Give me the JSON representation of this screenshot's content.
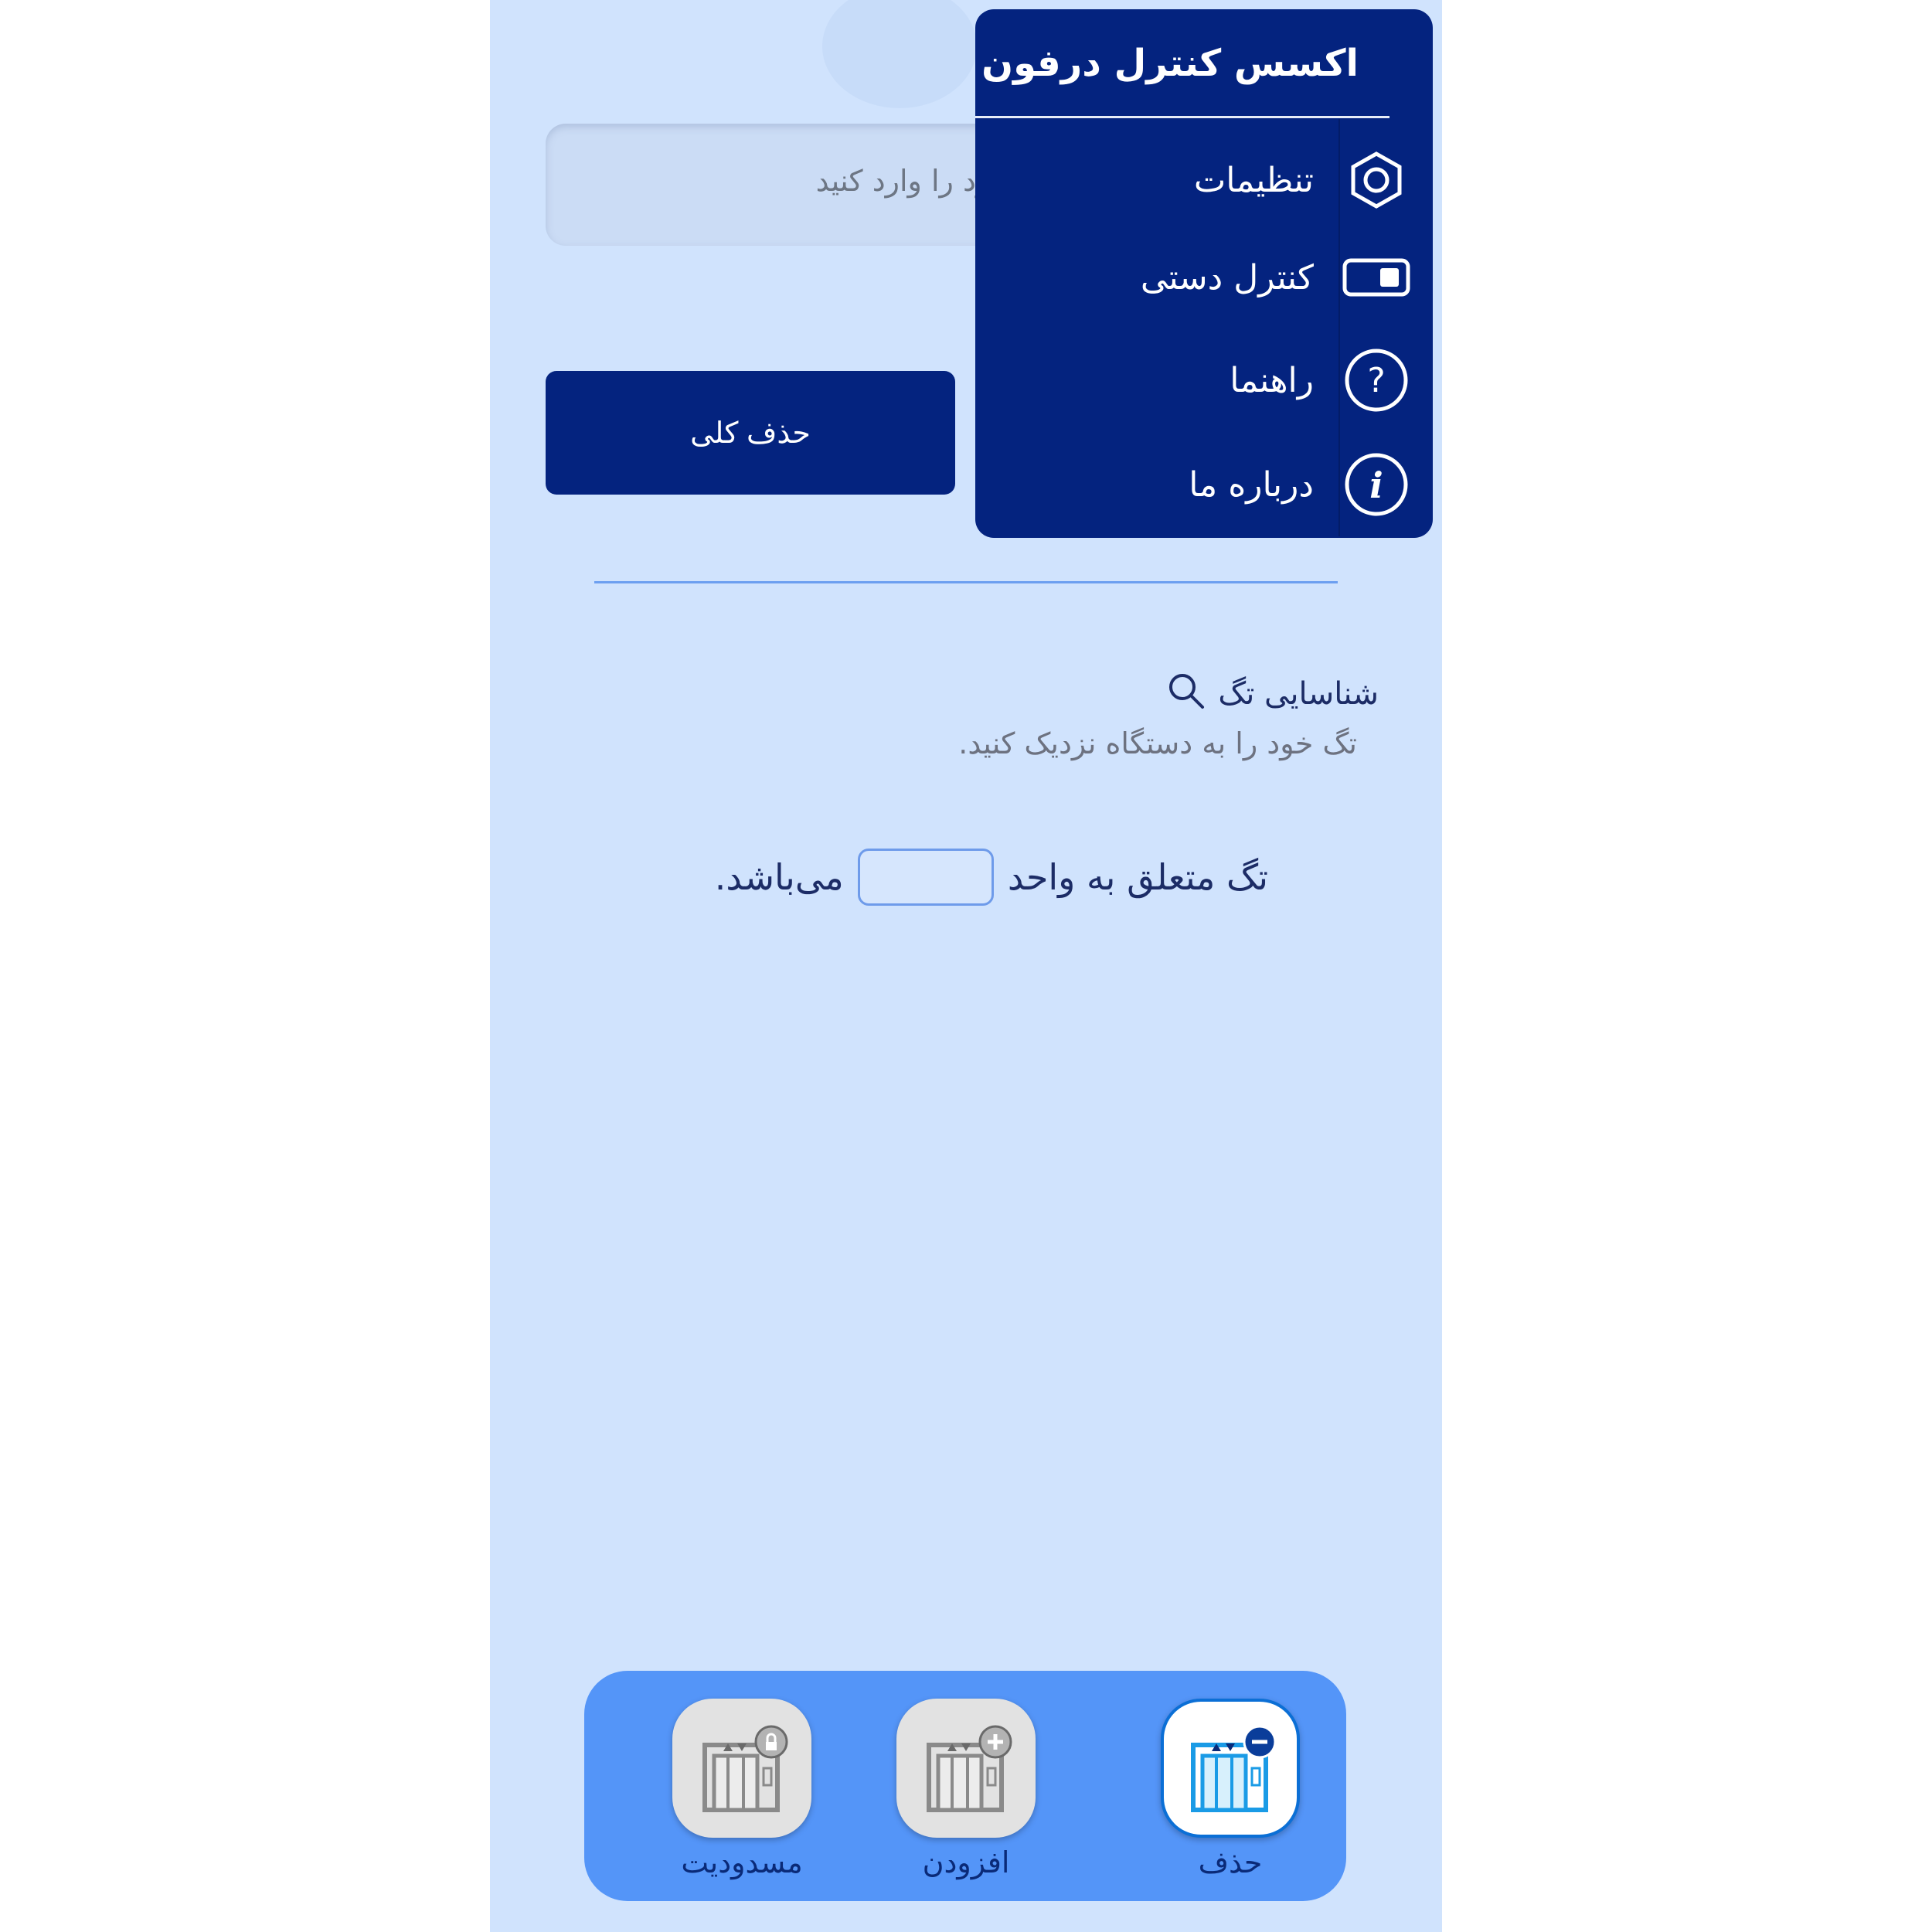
{
  "input": {
    "placeholder": "خود را وارد کنید"
  },
  "delete_all_label": "حذف کلی",
  "menu": {
    "title": "اکسس کنترل درفون",
    "items": [
      {
        "label": "تنظیمات",
        "icon": "gear-hexagon-icon"
      },
      {
        "label": "کنترل دستی",
        "icon": "toggle-icon"
      },
      {
        "label": "راهنما",
        "icon": "help-icon"
      },
      {
        "label": "درباره ما",
        "icon": "info-icon"
      }
    ]
  },
  "tag_section": {
    "title": "شناسایی تگ",
    "hint": "تگ خود را به دستگاه نزدیک کنید.",
    "unit_prefix": "تگ متعلق به واحد",
    "unit_value": "",
    "unit_suffix": "می‌باشد."
  },
  "bottom_nav": {
    "items": [
      {
        "label": "مسدودیت",
        "icon": "elevator-lock-icon",
        "active": false
      },
      {
        "label": "افزودن",
        "icon": "elevator-add-icon",
        "active": false
      },
      {
        "label": "حذف",
        "icon": "elevator-remove-icon",
        "active": true
      }
    ]
  },
  "colors": {
    "background": "#d0e3fd",
    "primary": "#04237f",
    "nav_bar": "#5495f8",
    "accent_line": "#6c9ff0"
  }
}
